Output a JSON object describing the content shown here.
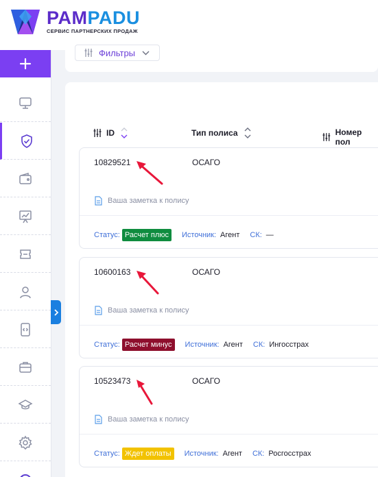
{
  "brand": {
    "name_part1": "PAM",
    "name_part2": "PADU",
    "tagline": "СЕРВИС ПАРТНЕРСКИХ ПРОДАЖ"
  },
  "sidebar": {
    "plus_icon": "plus-icon",
    "items": [
      {
        "icon": "monitor-icon",
        "active": false
      },
      {
        "icon": "shield-check-icon",
        "active": true
      },
      {
        "icon": "wallet-icon",
        "active": false
      },
      {
        "icon": "presentation-chart-icon",
        "active": false
      },
      {
        "icon": "ticket-icon",
        "active": false
      },
      {
        "icon": "user-icon",
        "active": false
      },
      {
        "icon": "phone-icon",
        "active": false
      },
      {
        "icon": "briefcase-icon",
        "active": false
      },
      {
        "icon": "graduation-cap-icon",
        "active": false
      },
      {
        "icon": "gear-icon",
        "active": false
      },
      {
        "icon": "help-circle-icon",
        "active": false
      }
    ]
  },
  "filters": {
    "label": "Фильтры",
    "icon": "sliders-icon"
  },
  "table": {
    "columns": {
      "id": "ID",
      "policy_type": "Тип полиса",
      "policy_number": "Номер пол"
    }
  },
  "colors": {
    "accent": "#7b3ff2",
    "link": "#3f6fd8",
    "status_plus": "#0f8c3f",
    "status_minus": "#8e0f2d",
    "status_waiting": "#f2c200",
    "arrow": "#e8173a"
  },
  "rows": [
    {
      "id": "10829521",
      "type": "ОСАГО",
      "note": "Ваша заметка к полису",
      "status_label": "Статус:",
      "status": "Расчет плюс",
      "source_label": "Источник:",
      "source": "Агент",
      "sk_label": "СК:",
      "sk": "—"
    },
    {
      "id": "10600163",
      "type": "ОСАГО",
      "note": "Ваша заметка к полису",
      "status_label": "Статус:",
      "status": "Расчет минус",
      "source_label": "Источник:",
      "source": "Агент",
      "sk_label": "СК:",
      "sk": "Ингосстрах"
    },
    {
      "id": "10523473",
      "type": "ОСАГО",
      "note": "Ваша заметка к полису",
      "status_label": "Статус:",
      "status": "Ждет оплаты",
      "source_label": "Источник:",
      "source": "Агент",
      "sk_label": "СК:",
      "sk": "Росгосстрах"
    }
  ]
}
